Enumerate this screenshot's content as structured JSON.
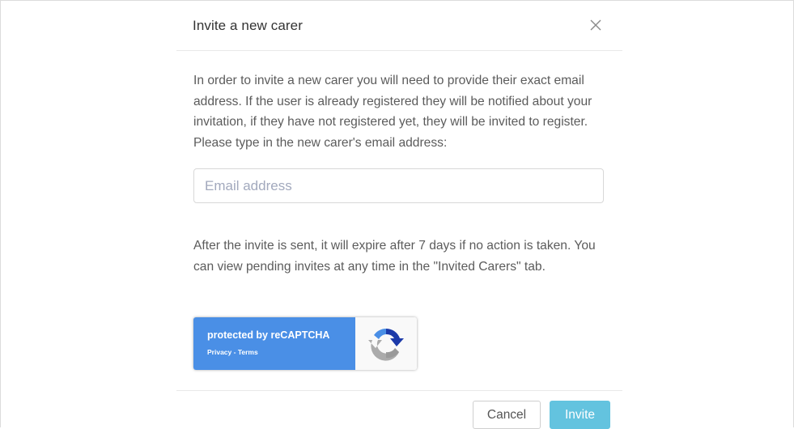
{
  "modal": {
    "title": "Invite a new carer",
    "intro_text": "In order to invite a new carer you will need to provide their exact email address. If the user is already registered they will be notified about your invitation, if they have not registered yet, they will be invited to register. Please type in the new carer's email address:",
    "email_input": {
      "value": "",
      "placeholder": "Email address"
    },
    "expiry_text": "After the invite is sent, it will expire after 7 days if no action is taken. You can view pending invites at any time in the \"Invited Carers\" tab.",
    "recaptcha": {
      "label": "protected by reCAPTCHA",
      "privacy_link": "Privacy",
      "separator": " - ",
      "terms_link": "Terms",
      "icon": "recaptcha-logo-icon"
    },
    "footer": {
      "cancel_label": "Cancel",
      "invite_label": "Invite"
    },
    "close_icon": "close-icon"
  },
  "colors": {
    "invite_button": "#5bc0de",
    "recaptcha_badge": "#4a8fe6",
    "body_text": "#5b5b5b",
    "placeholder": "#a2a9bd"
  }
}
